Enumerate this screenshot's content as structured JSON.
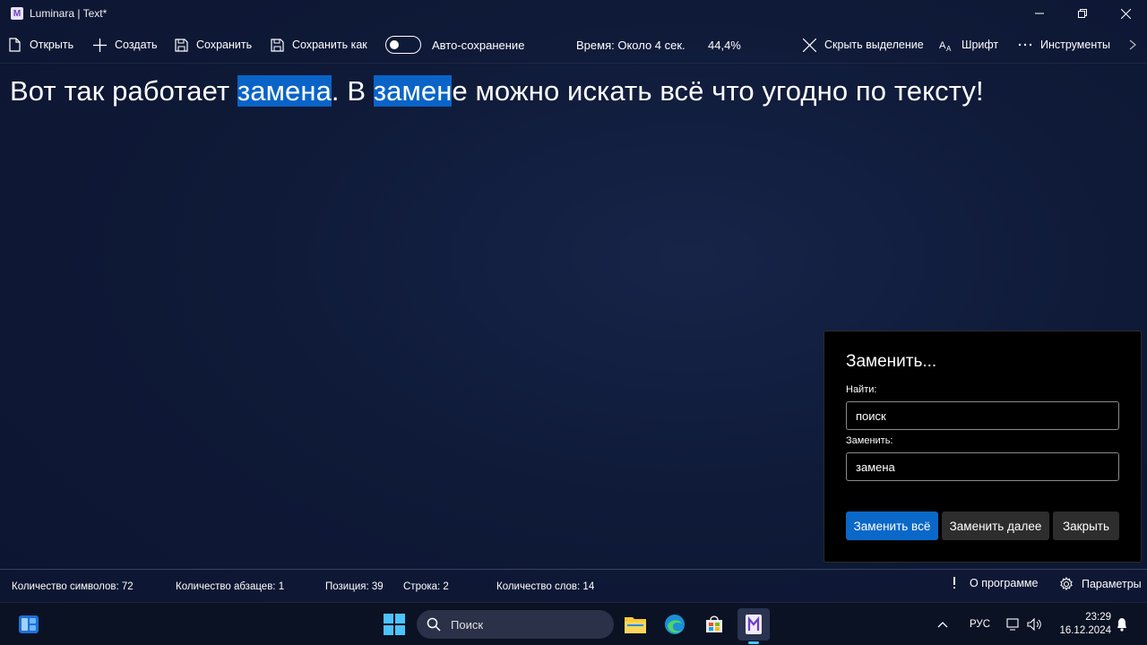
{
  "window": {
    "title": "Luminara | Text*",
    "app_icon": "luminara-icon"
  },
  "toolbar": {
    "open_label": "Открыть",
    "create_label": "Создать",
    "save_label": "Сохранить",
    "save_as_label": "Сохранить как",
    "autosave_label": "Авто-сохранение",
    "autosave_on": false,
    "time_label": "Время: Около 4 сек.",
    "progress_label": "44,4%",
    "hide_selection_label": "Скрыть выделение",
    "font_label": "Шрифт",
    "tools_label": "Инструменты"
  },
  "editor": {
    "segments": [
      "Вот так работает ",
      "замена",
      ". В ",
      "замен",
      "е можно искать всё что угодно по тексту!"
    ]
  },
  "replace_dialog": {
    "title": "Заменить...",
    "find_label": "Найти:",
    "find_value": "поиск",
    "replace_label": "Заменить:",
    "replace_value": "замена",
    "replace_all_label": "Заменить всё",
    "replace_next_label": "Заменить далее",
    "close_label": "Закрыть"
  },
  "statusbar": {
    "chars": "Количество символов: 72",
    "paragraphs": "Количество абзацев: 1",
    "position": "Позиция: 39",
    "line": "Строка: 2",
    "words": "Количество слов: 14",
    "about_label": "О программе",
    "settings_label": "Параметры"
  },
  "taskbar": {
    "search_placeholder": "Поиск",
    "language": "РУС",
    "time": "23:29",
    "date": "16.12.2024"
  },
  "colors": {
    "accent": "#0a68c8",
    "highlight": "#0a64c8",
    "background": "#0f1a38"
  }
}
